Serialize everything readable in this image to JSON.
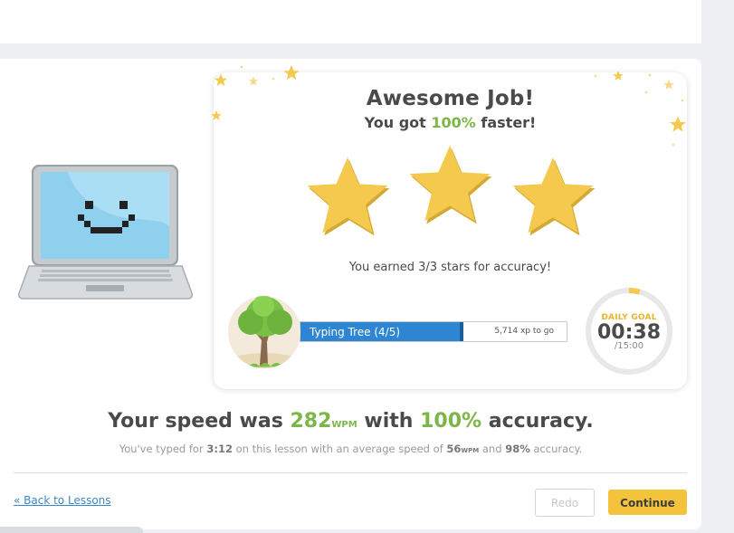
{
  "result": {
    "title": "Awesome Job!",
    "subtitle_prefix": "You got ",
    "subtitle_value": "100%",
    "subtitle_suffix": " faster!",
    "stars_earned": 3,
    "stars_total": 3,
    "stars_text": "You earned 3/3 stars for accuracy!"
  },
  "progress": {
    "label": "Typing Tree (4/5)",
    "xp_text": "5,714 xp to go",
    "fill_fraction": 0.6
  },
  "daily_goal": {
    "label": "DAILY GOAL",
    "time": "00:38",
    "total": "/15:00",
    "fraction": 0.042
  },
  "summary": {
    "speed_prefix": "Your speed was ",
    "speed_value": "282",
    "speed_unit": "WPM",
    "speed_mid": " with ",
    "accuracy_value": "100%",
    "accuracy_suffix": " accuracy.",
    "detail_1": "You've typed for ",
    "time_typed": "3:12",
    "detail_2": " on this lesson with an average speed of ",
    "avg_speed": "56",
    "avg_unit": "WPM",
    "detail_3": " and ",
    "avg_accuracy": "98%",
    "detail_4": " accuracy."
  },
  "footer": {
    "back_label": "« Back to Lessons",
    "redo_label": "Redo",
    "continue_label": "Continue"
  },
  "icons": {
    "laptop": "smiling-laptop-icon",
    "star": "star-icon",
    "tree": "tree-icon",
    "timer": "timer-ring-icon"
  },
  "colors": {
    "accent_green": "#7cb649",
    "star_gold": "#f5c94d",
    "progress_blue": "#2e86d2",
    "button_yellow": "#f5c33b",
    "link_blue": "#3a87c8"
  }
}
